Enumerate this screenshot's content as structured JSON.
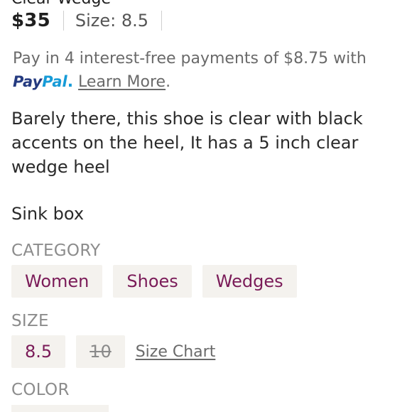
{
  "listing": {
    "title_partial": "Clear Wedge",
    "price": "$35",
    "size_label": "Size: 8.5"
  },
  "payment": {
    "text": "Pay in 4 interest-free payments of $8.75 with",
    "paypal_part1": "Pay",
    "paypal_part2": "Pal",
    "period_after_logo": ".",
    "learn_more": "Learn More",
    "trailing_period": "."
  },
  "description": {
    "paragraph1": "Barely there, this shoe is clear with black accents on the heel, It has a 5 inch clear wedge heel",
    "paragraph2": "Sink box"
  },
  "category": {
    "label": "CATEGORY",
    "items": [
      "Women",
      "Shoes",
      "Wedges"
    ]
  },
  "size": {
    "label": "SIZE",
    "options": [
      {
        "value": "8.5",
        "available": true
      },
      {
        "value": "10",
        "available": false
      }
    ],
    "size_chart_label": "Size Chart"
  },
  "color": {
    "label": "COLOR"
  },
  "colors": {
    "accent_plum": "#7a1b58",
    "chip_bg": "#f4f2ee",
    "paypal_dark": "#253b80",
    "paypal_light": "#179bd7"
  }
}
